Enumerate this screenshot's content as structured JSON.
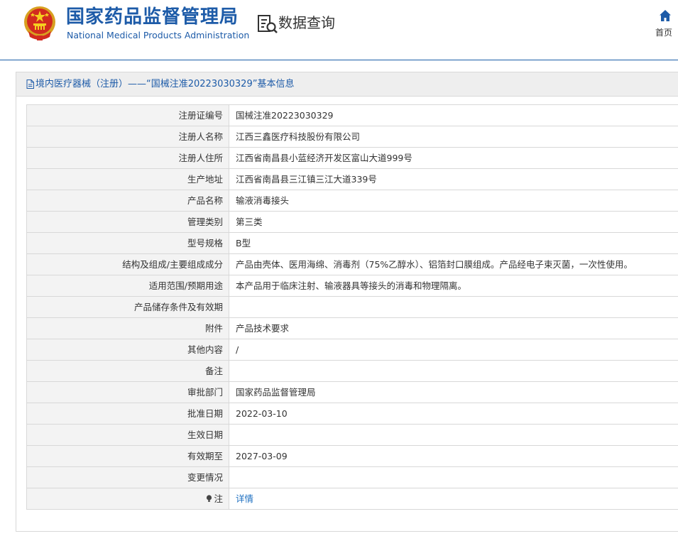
{
  "header": {
    "logo_cn": "国家药品监督管理局",
    "logo_en": "National Medical Products Administration",
    "query_title": "数据查询",
    "home_label": "首页",
    "brand_color": "#1d5ba8"
  },
  "panel": {
    "title": "境内医疗器械（注册）——“国械注准20223030329”基本信息"
  },
  "rows": [
    {
      "label": "注册证编号",
      "value": "国械注准20223030329"
    },
    {
      "label": "注册人名称",
      "value": "江西三鑫医疗科技股份有限公司"
    },
    {
      "label": "注册人住所",
      "value": "江西省南昌县小蓝经济开发区富山大道999号"
    },
    {
      "label": "生产地址",
      "value": "江西省南昌县三江镇三江大道339号"
    },
    {
      "label": "产品名称",
      "value": "输液消毒接头"
    },
    {
      "label": "管理类别",
      "value": "第三类"
    },
    {
      "label": "型号规格",
      "value": "B型"
    },
    {
      "label": "结构及组成/主要组成成分",
      "value": "产品由壳体、医用海绵、消毒剂（75%乙醇水）、铝箔封口膜组成。产品经电子束灭菌，一次性使用。"
    },
    {
      "label": "适用范围/预期用途",
      "value": "本产品用于临床注射、输液器具等接头的消毒和物理隔离。"
    },
    {
      "label": "产品储存条件及有效期",
      "value": ""
    },
    {
      "label": "附件",
      "value": "产品技术要求"
    },
    {
      "label": "其他内容",
      "value": "/"
    },
    {
      "label": "备注",
      "value": ""
    },
    {
      "label": "审批部门",
      "value": "国家药品监督管理局"
    },
    {
      "label": "批准日期",
      "value": "2022-03-10"
    },
    {
      "label": "生效日期",
      "value": ""
    },
    {
      "label": "有效期至",
      "value": "2027-03-09"
    },
    {
      "label": "变更情况",
      "value": ""
    }
  ],
  "note_row": {
    "label": "注",
    "icon": "lightbulb-icon",
    "link_text": "详情"
  }
}
